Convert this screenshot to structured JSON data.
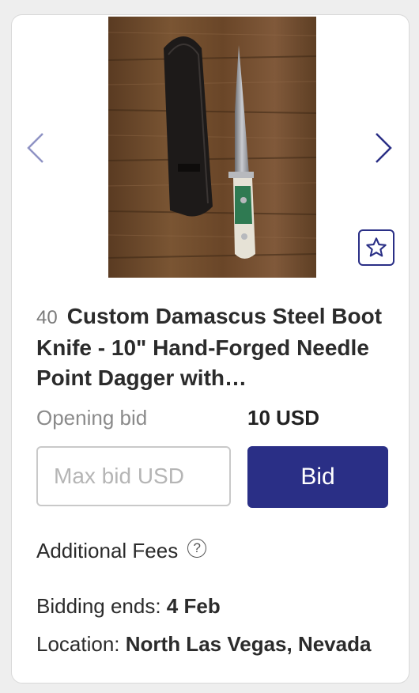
{
  "listing": {
    "image_alt": "Boot knife with leather sheath",
    "lot_number": "40",
    "title": "Custom Damascus Steel Boot Knife - 10\" Hand-Forged Needle Point Dagger with…",
    "opening_bid_label": "Opening bid",
    "opening_bid_value": "10 USD",
    "max_bid_placeholder": "Max bid USD",
    "bid_button_label": "Bid",
    "additional_fees_label": "Additional Fees",
    "help_symbol": "?",
    "bidding_ends_label": "Bidding ends:",
    "bidding_ends_value": "4 Feb",
    "location_label": "Location:",
    "location_value": "North Las Vegas, Nevada"
  },
  "icons": {
    "prev": "chevron-left-icon",
    "next": "chevron-right-icon",
    "favorite": "star-outline-icon"
  },
  "colors": {
    "accent": "#2a2f86",
    "arrow_left": "#8f93c4",
    "arrow_right": "#2a2f86"
  }
}
